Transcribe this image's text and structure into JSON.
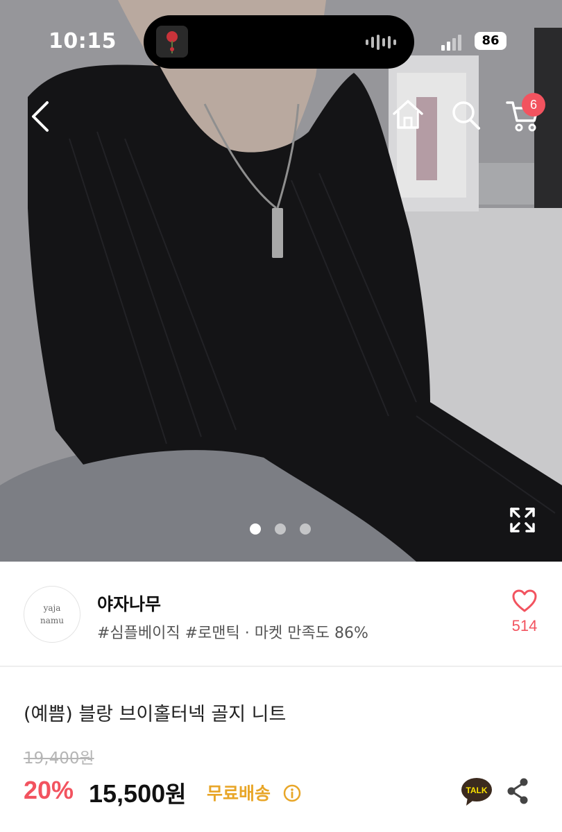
{
  "status_bar": {
    "time": "10:15",
    "battery": "86"
  },
  "nav": {
    "cart_count": "6",
    "icons": [
      "back-icon",
      "home-icon",
      "search-icon",
      "cart-icon",
      "expand-icon"
    ]
  },
  "gallery": {
    "slide_count": 3,
    "active_slide": 1
  },
  "shop": {
    "logo_line1": "yaja",
    "logo_line2": "namu",
    "name": "야자나무",
    "tags": "#심플베이직 #로맨틱 · 마켓 만족도 86%",
    "like_count": "514"
  },
  "product": {
    "title": "(예쁨) 블랑 브이홀터넥 골지 니트",
    "original_price": "19,400원",
    "discount": "20%",
    "price_number": "15,500",
    "price_unit": "원",
    "free_shipping": "무료배송",
    "talk_label": "TALK"
  },
  "colors": {
    "accent": "#f2535f",
    "shipping": "#e8a628",
    "kakao": "#fae100"
  }
}
